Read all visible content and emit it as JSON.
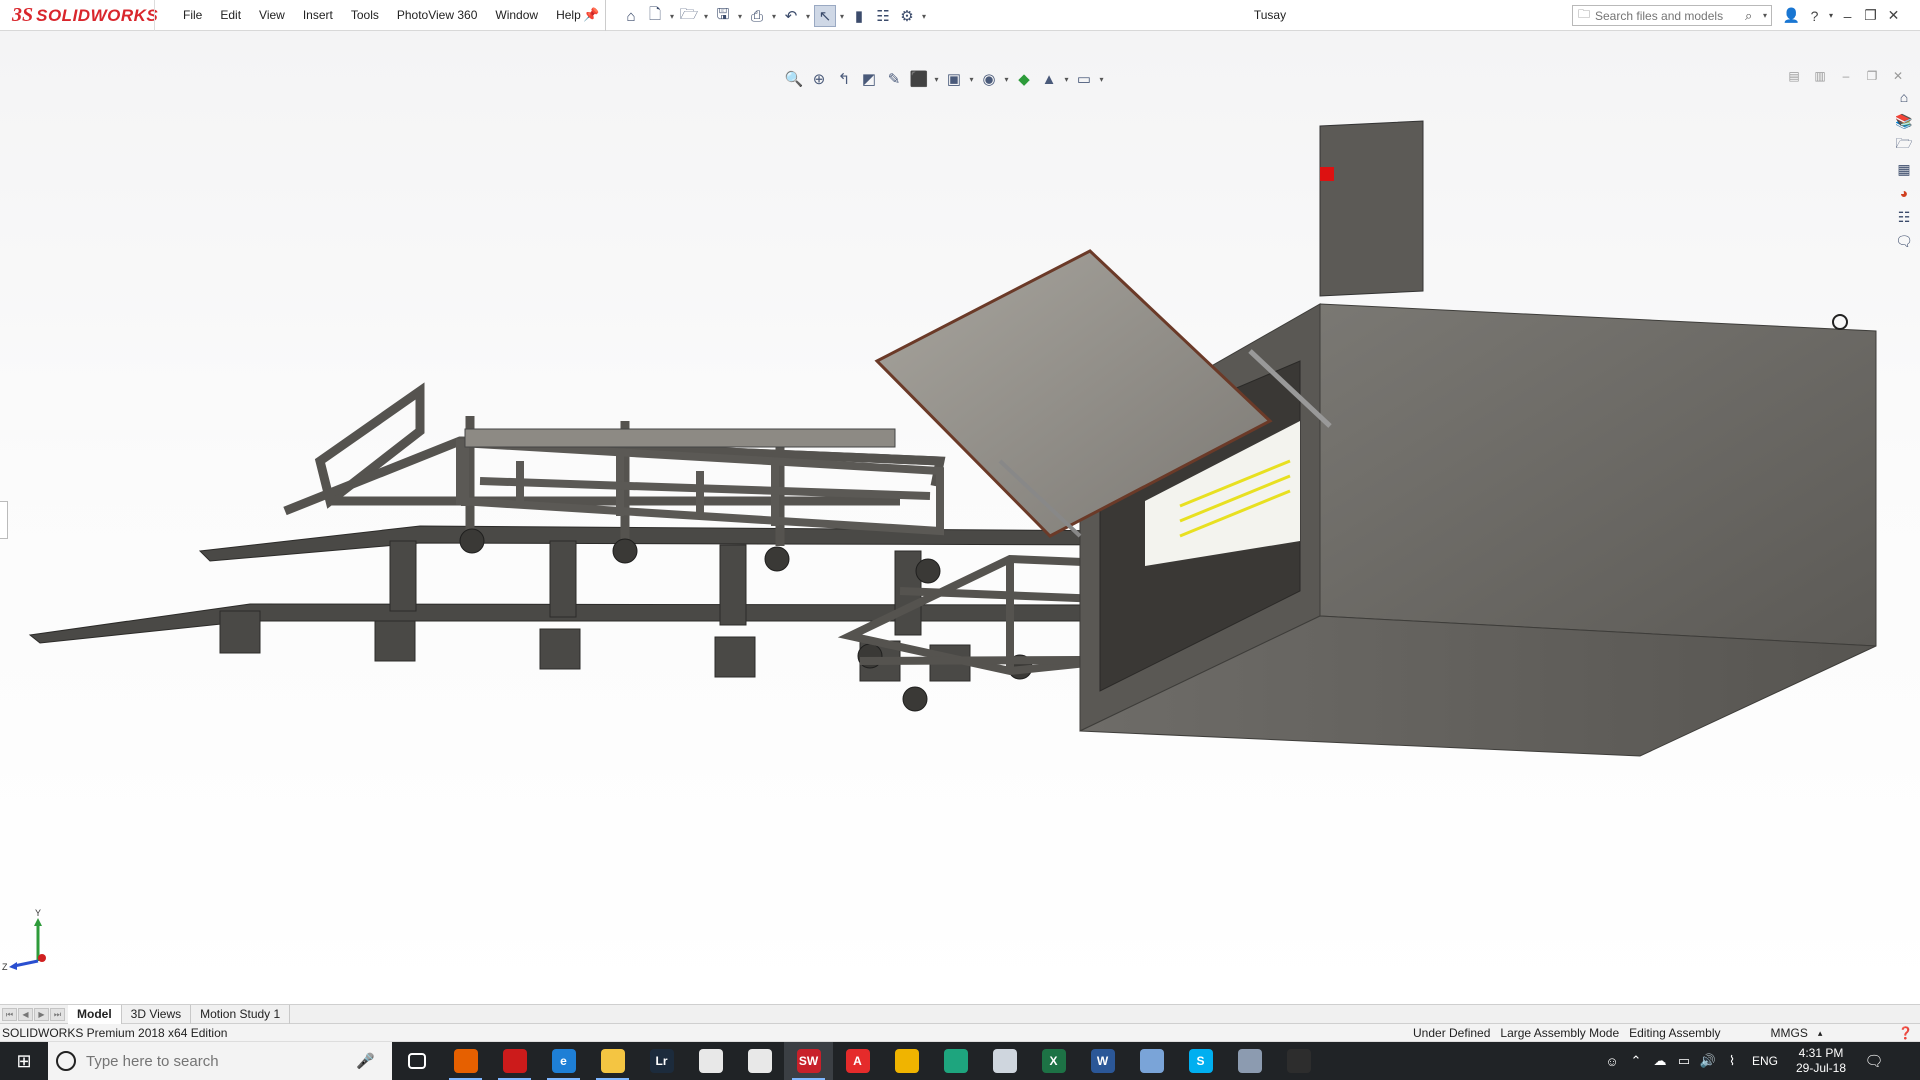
{
  "app": {
    "brand": "SOLIDWORKS",
    "document_title": "Tusay"
  },
  "menu": [
    "File",
    "Edit",
    "View",
    "Insert",
    "Tools",
    "PhotoView 360",
    "Window",
    "Help"
  ],
  "quick_access_icons": [
    "home-icon",
    "new-document-icon",
    "open-icon",
    "save-icon",
    "print-icon",
    "undo-icon",
    "select-icon",
    "rebuild-icon",
    "file-properties-icon",
    "options-icon"
  ],
  "search": {
    "placeholder": "Search files and models"
  },
  "heads_up_toolbar_icons": [
    "zoom-to-fit-icon",
    "zoom-to-area-icon",
    "previous-view-icon",
    "section-view-icon",
    "dynamic-annotation-icon",
    "view-orientation-icon",
    "display-style-icon",
    "hide-show-icon",
    "edit-appearance-icon",
    "apply-scene-icon",
    "view-settings-icon"
  ],
  "task_pane_icons": [
    "solidworks-resources-icon",
    "design-library-icon",
    "file-explorer-icon",
    "view-palette-icon",
    "appearances-icon",
    "custom-properties-icon",
    "forum-icon"
  ],
  "triad": {
    "y_label": "Y",
    "z_label": "Z"
  },
  "tabs": [
    {
      "label": "Model",
      "active": true
    },
    {
      "label": "3D Views",
      "active": false
    },
    {
      "label": "Motion Study 1",
      "active": false
    }
  ],
  "status": {
    "edition": "SOLIDWORKS Premium 2018 x64 Edition",
    "definition": "Under Defined",
    "mode": "Large Assembly Mode",
    "editing": "Editing Assembly",
    "units": "MMGS"
  },
  "taskbar": {
    "search_placeholder": "Type here to search",
    "apps": [
      {
        "icon": "task-view-icon",
        "label": "",
        "color": "#202326"
      },
      {
        "icon": "firefox-icon",
        "label": "",
        "color": "#e66000"
      },
      {
        "icon": "opera-icon",
        "label": "",
        "color": "#cc1b1b"
      },
      {
        "icon": "edge-icon",
        "label": "e",
        "color": "#1e7fd6"
      },
      {
        "icon": "file-explorer-icon",
        "label": "",
        "color": "#f4c542"
      },
      {
        "icon": "lightroom-icon",
        "label": "Lr",
        "color": "#1c2b3c"
      },
      {
        "icon": "store-icon",
        "label": "",
        "color": "#e8e8e8"
      },
      {
        "icon": "mail-icon",
        "label": "",
        "color": "#e8e8e8"
      },
      {
        "icon": "solidworks-icon",
        "label": "SW",
        "color": "#c8202a"
      },
      {
        "icon": "acrobat-icon",
        "label": "A",
        "color": "#e52b2b"
      },
      {
        "icon": "app-icon",
        "label": "",
        "color": "#f0b400"
      },
      {
        "icon": "keyshot-icon",
        "label": "",
        "color": "#1ea57e"
      },
      {
        "icon": "app-icon-2",
        "label": "",
        "color": "#cfd6de"
      },
      {
        "icon": "excel-icon",
        "label": "X",
        "color": "#1d7245"
      },
      {
        "icon": "word-icon",
        "label": "W",
        "color": "#2b5797"
      },
      {
        "icon": "app-icon-3",
        "label": "",
        "color": "#7aa4d8"
      },
      {
        "icon": "skype-icon",
        "label": "S",
        "color": "#00aff0"
      },
      {
        "icon": "app-icon-4",
        "label": "",
        "color": "#8c9bb0"
      },
      {
        "icon": "photos-icon",
        "label": "",
        "color": "#2d2d2d"
      }
    ],
    "lang": "ENG",
    "time": "4:31 PM",
    "date": "29-Jul-18"
  }
}
